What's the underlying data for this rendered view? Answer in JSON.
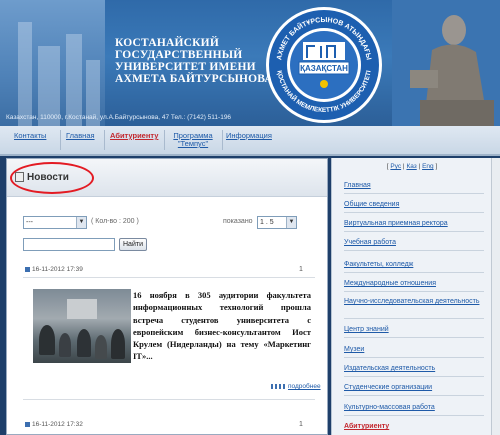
{
  "header": {
    "title_lines": [
      "КОСТАНАЙСКИЙ",
      "ГОСУДАРСТВЕННЫЙ",
      "УНИВЕРСИТЕТ ИМЕНИ",
      "АХМЕТА БАЙТУРСЫНОВА"
    ],
    "address": "Казахстан, 110000, г.Костанай, ул.А.Байтурсынова, 47   Тел.: (7142) 511-196",
    "logo_top_text": "АХМЕТ БАЙТҰРСЫНОВ АТЫНДАҒЫ",
    "logo_center_text": "ҚАЗАҚСТАН",
    "logo_bottom_text": "ҚОСТАНАЙ МЕМЛЕКЕТТІК УНИВЕРСИТЕТІ"
  },
  "nav": {
    "items": [
      {
        "label": "Контакты"
      },
      {
        "label": "Главная"
      },
      {
        "label": "Абитуриенту"
      },
      {
        "label": "Программа \"Темпус\""
      },
      {
        "label": "Информация"
      }
    ]
  },
  "news": {
    "title": "Новости",
    "category_select": "---",
    "count_label": "( Кол-во : 200 )",
    "shown_label": "показано",
    "range_select": "1 . 5",
    "search_value": "",
    "find_button": "Найти",
    "item1": {
      "date": "16-11-2012 17:39",
      "number": "1",
      "text": "16 ноября в 305 аудитории факультета информационных технологий прошла встреча студентов университета с европейским бизнес-консультантом Иост Крулем (Нидерланды) на тему «Маркетинг IT»...",
      "more": "подробнее"
    },
    "item2": {
      "date": "16-11-2012 17:32",
      "number": "1"
    }
  },
  "sidebar": {
    "langs": [
      "Рус",
      "Каз",
      "Eng"
    ],
    "links": [
      {
        "label": "Главная"
      },
      {
        "label": "Общие сведения"
      },
      {
        "label": "Виртуальная приемная ректора"
      },
      {
        "label": "Учебная работа"
      },
      {
        "label": "Факультеты, колледж"
      },
      {
        "label": "Международные отношения"
      },
      {
        "label": "Научно-исследовательская деятельность"
      },
      {
        "label": "Центр знаний"
      },
      {
        "label": "Музеи"
      },
      {
        "label": "Издательская деятельность"
      },
      {
        "label": "Студенческие организации"
      },
      {
        "label": "Культурно-массовая работа"
      },
      {
        "label": "Абитуриенту"
      }
    ]
  }
}
